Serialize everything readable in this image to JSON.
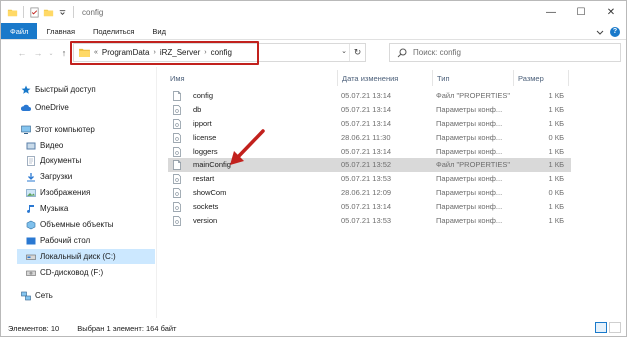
{
  "window": {
    "title": "config",
    "minimize": "—",
    "maximize": "☐",
    "close": "✕"
  },
  "ribbon": {
    "tabs": [
      "Файл",
      "Главная",
      "Поделиться",
      "Вид"
    ],
    "accent": "#1979ca"
  },
  "address": {
    "prefix": "«",
    "crumbs": [
      "ProgramData",
      "iRZ_Server",
      "config"
    ],
    "separator": "›"
  },
  "search": {
    "placeholder": "Поиск: config"
  },
  "nav": {
    "items": [
      {
        "label": "Быстрый доступ",
        "icon": "star-icon"
      },
      {
        "label": "OneDrive",
        "icon": "cloud-icon"
      },
      {
        "label": "Этот компьютер",
        "icon": "computer-icon"
      },
      {
        "label": "Видео",
        "icon": "video-folder-icon"
      },
      {
        "label": "Документы",
        "icon": "documents-folder-icon"
      },
      {
        "label": "Загрузки",
        "icon": "downloads-folder-icon"
      },
      {
        "label": "Изображения",
        "icon": "pictures-folder-icon"
      },
      {
        "label": "Музыка",
        "icon": "music-folder-icon"
      },
      {
        "label": "Объемные объекты",
        "icon": "3d-objects-folder-icon"
      },
      {
        "label": "Рабочий стол",
        "icon": "desktop-folder-icon"
      },
      {
        "label": "Локальный диск (C:)",
        "icon": "drive-icon"
      },
      {
        "label": "CD-дисковод (F:)",
        "icon": "cd-drive-icon"
      },
      {
        "label": "Сеть",
        "icon": "network-icon"
      }
    ]
  },
  "columns": {
    "name": "Имя",
    "date": "Дата изменения",
    "type": "Тип",
    "size": "Размер"
  },
  "files": [
    {
      "name": "config",
      "date": "05.07.21 13:14",
      "type": "Файл \"PROPERTIES\"",
      "size": "1 КБ"
    },
    {
      "name": "db",
      "date": "05.07.21 13:14",
      "type": "Параметры конф...",
      "size": "1 КБ"
    },
    {
      "name": "ipport",
      "date": "05.07.21 13:14",
      "type": "Параметры конф...",
      "size": "1 КБ"
    },
    {
      "name": "license",
      "date": "28.06.21 11:30",
      "type": "Параметры конф...",
      "size": "0 КБ"
    },
    {
      "name": "loggers",
      "date": "05.07.21 13:14",
      "type": "Параметры конф...",
      "size": "1 КБ"
    },
    {
      "name": "mainConfig",
      "date": "05.07.21 13:52",
      "type": "Файл \"PROPERTIES\"",
      "size": "1 КБ"
    },
    {
      "name": "restart",
      "date": "05.07.21 13:53",
      "type": "Параметры конф...",
      "size": "1 КБ"
    },
    {
      "name": "showCom",
      "date": "28.06.21 12:09",
      "type": "Параметры конф...",
      "size": "0 КБ"
    },
    {
      "name": "sockets",
      "date": "05.07.21 13:14",
      "type": "Параметры конф...",
      "size": "1 КБ"
    },
    {
      "name": "version",
      "date": "05.07.21 13:53",
      "type": "Параметры конф...",
      "size": "1 КБ"
    }
  ],
  "status": {
    "count": "Элементов: 10",
    "selection": "Выбран 1 элемент: 164 байт"
  },
  "colors": {
    "annotation_red": "#c2211d",
    "selection_blue": "#cce8ff",
    "selected_row": "#d9d9d9"
  }
}
